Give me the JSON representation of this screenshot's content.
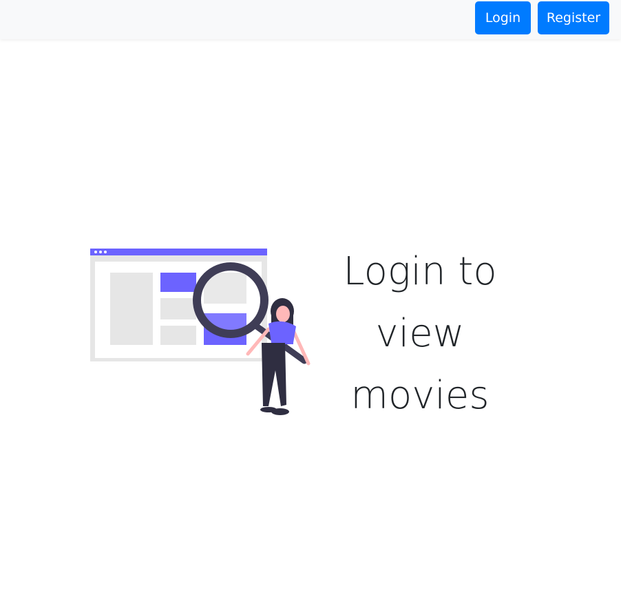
{
  "navbar": {
    "login_label": "Login",
    "register_label": "Register"
  },
  "hero": {
    "lines": [
      "Login to",
      "view",
      "movies"
    ]
  },
  "illustration": {
    "icon": "search-illustration-icon",
    "colors": {
      "accent": "#6c63ff",
      "frame": "#e6e6e6",
      "dark": "#3f3d56"
    }
  },
  "colors": {
    "button": "#007bff",
    "navbar_bg": "#f8f9fa",
    "text": "#212529"
  }
}
